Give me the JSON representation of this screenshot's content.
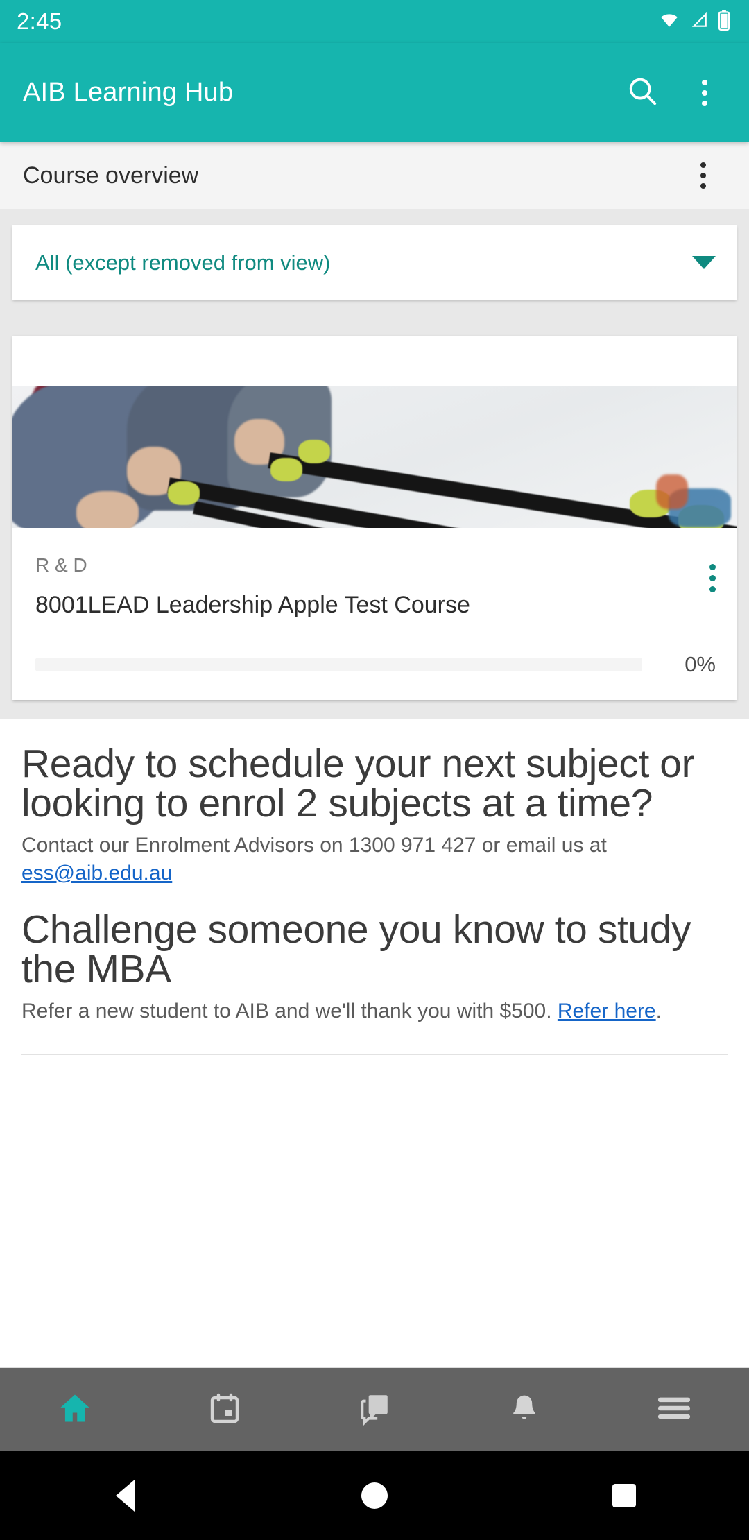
{
  "status_bar": {
    "time": "2:45",
    "icons": [
      "wifi-icon",
      "cellular-signal-icon",
      "battery-icon"
    ]
  },
  "app_bar": {
    "title": "AIB Learning Hub",
    "search_icon": "search-icon",
    "overflow_icon": "overflow-menu-icon",
    "background_color": "#16b5ae"
  },
  "section_header": {
    "title": "Course overview",
    "overflow_icon": "overflow-menu-icon"
  },
  "filter": {
    "selected": "All (except removed from view)",
    "caret_icon": "chevron-down-icon",
    "accent_color": "#0f8a80"
  },
  "course_card": {
    "image_alt": "rowing-team-photo",
    "category": "R & D",
    "title": "8001LEAD Leadership Apple Test Course",
    "overflow_icon": "overflow-menu-icon",
    "progress_percent": 0,
    "progress_label": "0%"
  },
  "promo": {
    "blocks": [
      {
        "heading": "Ready to schedule your next subject or looking to enrol 2 subjects at a time?",
        "body_before": "Contact our Enrolment Advisors on 1300 971 427 or email us at ",
        "link_text": "ess@aib.edu.au",
        "body_after": ""
      },
      {
        "heading": "Challenge someone you know to study the MBA",
        "body_before": "Refer a new student to AIB and we'll thank you with $500. ",
        "link_text": "Refer here",
        "body_after": "."
      }
    ],
    "link_color": "#1565c8"
  },
  "bottom_nav": {
    "items": [
      {
        "label": "Home",
        "icon": "home-icon",
        "active": true
      },
      {
        "label": "Calendar",
        "icon": "calendar-icon",
        "active": false
      },
      {
        "label": "Messages",
        "icon": "chat-bubble-icon",
        "active": false
      },
      {
        "label": "Notifications",
        "icon": "bell-icon",
        "active": false
      },
      {
        "label": "More",
        "icon": "hamburger-menu-icon",
        "active": false
      }
    ],
    "active_color": "#16b5ae",
    "inactive_color": "#d4d4d4",
    "background_color": "#636363"
  },
  "system_nav": {
    "back": "back-triangle-icon",
    "home": "home-circle-icon",
    "recents": "recents-square-icon"
  }
}
